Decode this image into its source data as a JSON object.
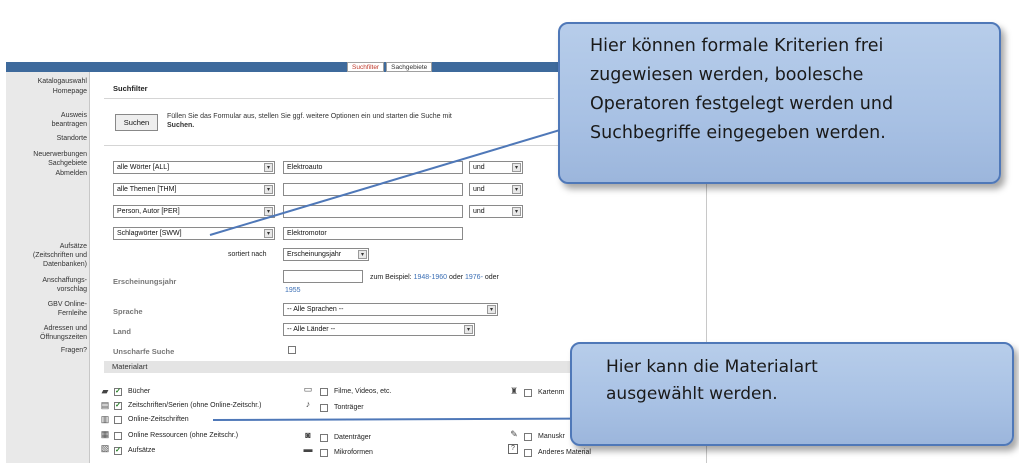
{
  "tabs": {
    "suchfilter": "Suchfilter",
    "sachgebiete": "Sachgebiete"
  },
  "sidebar": {
    "items": [
      "Katalogauswahl",
      "Homepage",
      "Ausweis",
      "beantragen",
      "Standorte",
      "Neuerwerbungen",
      "Sachgebiete",
      "Abmelden",
      "Aufsätze",
      "(Zeitschriften und",
      "Datenbanken)",
      "Anschaffungs-",
      "vorschlag",
      "GBV Online-",
      "Fernleihe",
      "Adressen und",
      "Öffnungszeiten",
      "Fragen?"
    ]
  },
  "form": {
    "title": "Suchfilter",
    "search_button": "Suchen",
    "info_text": "Füllen Sie das Formular aus, stellen Sie ggf. weitere Optionen ein und starten die Suche mit",
    "info_bold": "Suchen.",
    "rows": [
      {
        "field": "alle Wörter [ALL]",
        "term": "Elektroauto",
        "op": "und"
      },
      {
        "field": "alle Themen [THM]",
        "term": "",
        "op": "und"
      },
      {
        "field": "Person, Autor [PER]",
        "term": "",
        "op": "und"
      },
      {
        "field": "Schlagwörter [SWW]",
        "term": "Elektromotor",
        "op": ""
      }
    ],
    "sort_label": "sortiert nach",
    "sort_value": "Erscheinungsjahr",
    "year_label": "Erscheinungsjahr",
    "year_example_prefix": "zum Beispiel:",
    "year_example_1": "1948-1960",
    "year_example_or1": "oder",
    "year_example_2": "1976-",
    "year_example_or2": "oder",
    "year_example_3": "1955",
    "language_label": "Sprache",
    "language_value": "-- Alle Sprachen --",
    "country_label": "Land",
    "country_value": "-- Alle Länder --",
    "fuzzy_label": "Unscharfe Suche"
  },
  "materials": {
    "header": "Materialart",
    "col1": [
      {
        "label": "Bücher",
        "checked": true,
        "icon": "book-icon"
      },
      {
        "label": "Zeitschriften/Serien (ohne Online-Zeitschr.)",
        "checked": true,
        "icon": "journal-icon"
      },
      {
        "label": "Online-Zeitschriften",
        "checked": false,
        "icon": "online-journal-icon"
      },
      {
        "label": "Online Ressourcen (ohne Zeitschr.)",
        "checked": false,
        "icon": "online-resource-icon"
      },
      {
        "label": "Aufsätze",
        "checked": true,
        "icon": "article-icon"
      }
    ],
    "col2": [
      {
        "label": "Filme, Videos, etc.",
        "checked": false,
        "icon": "film-icon"
      },
      {
        "label": "Tonträger",
        "checked": false,
        "icon": "audio-icon"
      },
      {
        "label": "Datenträger",
        "checked": false,
        "icon": "disk-icon"
      },
      {
        "label": "Mikroformen",
        "checked": false,
        "icon": "microform-icon"
      }
    ],
    "col3": [
      {
        "label": "Kartenm",
        "checked": false,
        "icon": "map-icon"
      },
      {
        "label": "Manuskr",
        "checked": false,
        "icon": "manuscript-icon"
      },
      {
        "label": "Anderes Material",
        "checked": false,
        "icon": "question-icon"
      }
    ]
  },
  "callouts": {
    "top": [
      "Hier können formale Kriterien frei",
      "zugewiesen werden, boolesche",
      "Operatoren festgelegt werden und",
      "Suchbegriffe eingegeben werden."
    ],
    "bottom": [
      "Hier kann die Materialart",
      "ausgewählt werden."
    ]
  },
  "colors": {
    "band": "#3e6a9c",
    "callout_fill": "#a8c1e4",
    "callout_border": "#4f78b8",
    "link": "#3b6fb5",
    "active_tab": "#c0392b"
  }
}
